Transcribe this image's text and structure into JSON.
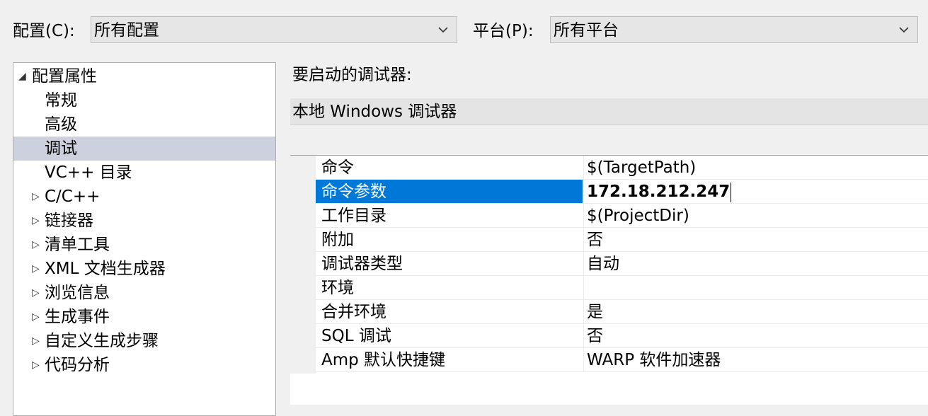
{
  "topbar": {
    "config_label": "配置(C):",
    "config_value": "所有配置",
    "platform_label": "平台(P):",
    "platform_value": "所有平台"
  },
  "tree": {
    "root": "配置属性",
    "children": [
      "常规",
      "高级",
      "调试",
      "VC++ 目录"
    ],
    "groups": [
      "C/C++",
      "链接器",
      "清单工具",
      "XML 文档生成器",
      "浏览信息",
      "生成事件",
      "自定义生成步骤",
      "代码分析"
    ]
  },
  "right": {
    "debugger_label": "要启动的调试器:",
    "debugger_value": "本地 Windows 调试器"
  },
  "properties": [
    {
      "name": "命令",
      "value": "$(TargetPath)"
    },
    {
      "name": "命令参数",
      "value": "172.18.212.247"
    },
    {
      "name": "工作目录",
      "value": "$(ProjectDir)"
    },
    {
      "name": "附加",
      "value": "否"
    },
    {
      "name": "调试器类型",
      "value": "自动"
    },
    {
      "name": "环境",
      "value": ""
    },
    {
      "name": "合并环境",
      "value": "是"
    },
    {
      "name": "SQL 调试",
      "value": "否"
    },
    {
      "name": "Amp 默认快捷键",
      "value": "WARP 软件加速器"
    }
  ],
  "colors": {
    "selection": "#0078d7",
    "tree_selection": "#cdd0dd"
  }
}
